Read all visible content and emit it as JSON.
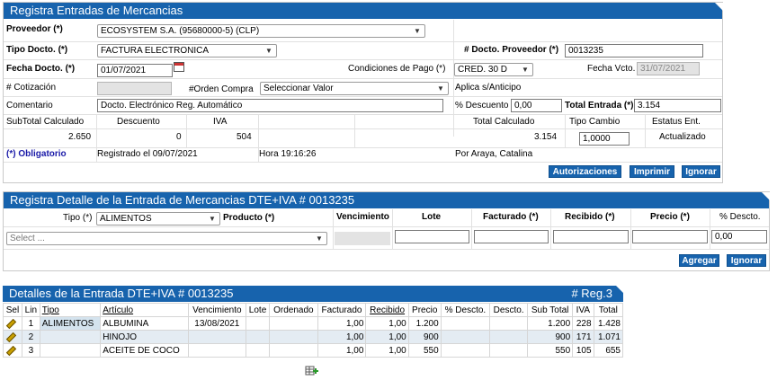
{
  "header": {
    "title": "Registra Entradas de Mercancias",
    "proveedor_label": "Proveedor (*)",
    "proveedor_value": "ECOSYSTEM S.A. (95680000-5) (CLP)",
    "tipo_docto_label": "Tipo Docto. (*)",
    "tipo_docto_value": "FACTURA ELECTRONICA",
    "num_docto_label": "# Docto. Proveedor (*)",
    "num_docto_value": "0013235",
    "fecha_docto_label": "Fecha Docto. (*)",
    "fecha_docto_value": "01/07/2021",
    "condiciones_label": "Condiciones de Pago (*)",
    "condiciones_value": "CRED. 30 D",
    "fecha_vcto_label": "Fecha Vcto.",
    "fecha_vcto_value": "31/07/2021",
    "cotizacion_label": "# Cotización",
    "orden_compra_label": "#Orden Compra",
    "orden_compra_value": "Seleccionar Valor",
    "anticipo_label": "Aplica s/Anticipo",
    "comentario_label": "Comentario",
    "comentario_value": "Docto. Electrónico Reg. Automático",
    "descuento_pct_label": "% Descuento",
    "descuento_pct_value": "0,00",
    "total_entrada_label": "Total Entrada (*)",
    "total_entrada_value": "3.154",
    "subtotal_label": "SubTotal Calculado",
    "subtotal_value": "2.650",
    "descuento_label": "Descuento",
    "descuento_value": "0",
    "iva_label": "IVA",
    "iva_value": "504",
    "total_calc_label": "Total Calculado",
    "total_calc_value": "3.154",
    "tipo_cambio_label": "Tipo Cambio",
    "tipo_cambio_value": "1,0000",
    "estatus_label": "Estatus Ent.",
    "estatus_value": "Actualizado",
    "obligatorio": "(*) Obligatorio",
    "registrado": "Registrado el 09/07/2021",
    "hora": "Hora 19:16:26",
    "por": "Por Araya, Catalina",
    "btn_autorizaciones": "Autorizaciones",
    "btn_imprimir": "Imprimir",
    "btn_ignorar": "Ignorar"
  },
  "detail": {
    "title": "Registra Detalle de la Entrada de Mercancias DTE+IVA # 0013235",
    "tipo_label": "Tipo (*)",
    "tipo_value": "ALIMENTOS",
    "producto_label": "Producto (*)",
    "producto_placeholder": "Select ...",
    "vencimiento_label": "Vencimiento",
    "lote_label": "Lote",
    "facturado_label": "Facturado (*)",
    "recibido_label": "Recibido (*)",
    "precio_label": "Precio (*)",
    "descto_label": "% Descto.",
    "descto_value": "0,00",
    "btn_agregar": "Agregar",
    "btn_ignorar": "Ignorar"
  },
  "lines": {
    "title": "Detalles de la Entrada DTE+IVA # 0013235",
    "reg_count": "# Reg.3",
    "columns": [
      "Sel",
      "Lin",
      "Tipo",
      "Artículo",
      "Vencimiento",
      "Lote",
      "Ordenado",
      "Facturado",
      "Recibido",
      "Precio",
      "% Descto.",
      "Descto.",
      "Sub Total",
      "IVA",
      "Total"
    ],
    "rows": [
      {
        "lin": "1",
        "tipo": "ALIMENTOS",
        "articulo": "ALBUMINA",
        "vencimiento": "13/08/2021",
        "lote": "",
        "ordenado": "",
        "facturado": "1,00",
        "recibido": "1,00",
        "precio": "1.200",
        "pct_descto": "",
        "descto": "",
        "subtotal": "1.200",
        "iva": "228",
        "total": "1.428"
      },
      {
        "lin": "2",
        "tipo": "",
        "articulo": "HINOJO",
        "vencimiento": "",
        "lote": "",
        "ordenado": "",
        "facturado": "1,00",
        "recibido": "1,00",
        "precio": "900",
        "pct_descto": "",
        "descto": "",
        "subtotal": "900",
        "iva": "171",
        "total": "1.071"
      },
      {
        "lin": "3",
        "tipo": "",
        "articulo": "ACEITE DE COCO",
        "vencimiento": "",
        "lote": "",
        "ordenado": "",
        "facturado": "1,00",
        "recibido": "1,00",
        "precio": "550",
        "pct_descto": "",
        "descto": "",
        "subtotal": "550",
        "iva": "105",
        "total": "655"
      }
    ]
  },
  "colors": {
    "header_blue": "#1763ad",
    "highlight_cell": "#d4e3ee"
  },
  "icons": {
    "edit": "pencil-icon",
    "calendar": "calendar-icon",
    "excel": "excel-export-icon"
  }
}
